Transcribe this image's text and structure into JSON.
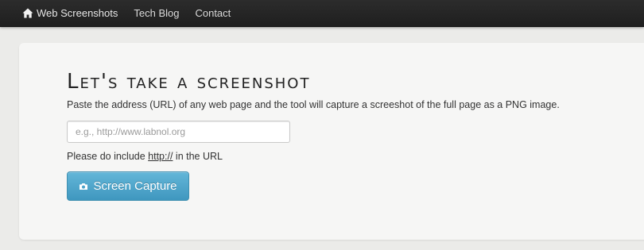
{
  "nav": {
    "brand_label": "Web Screenshots",
    "brand_icon": "home-icon",
    "links": [
      "Tech Blog",
      "Contact"
    ]
  },
  "hero": {
    "title": "Let's take a screenshot",
    "description": "Paste the address (URL) of any web page and the tool will capture a screeshot of the full page as a PNG image.",
    "input_placeholder": "e.g., http://www.labnol.org",
    "input_value": "",
    "hint_prefix": "Please do include ",
    "hint_link": "http://",
    "hint_suffix": " in the URL",
    "button_label": "Screen Capture",
    "button_icon": "camera-icon"
  },
  "colors": {
    "navbar": "#222222",
    "page_background": "#ebebe9",
    "panel_background": "#f6f6f5",
    "button": "#4aa3ca",
    "text": "#333333"
  }
}
